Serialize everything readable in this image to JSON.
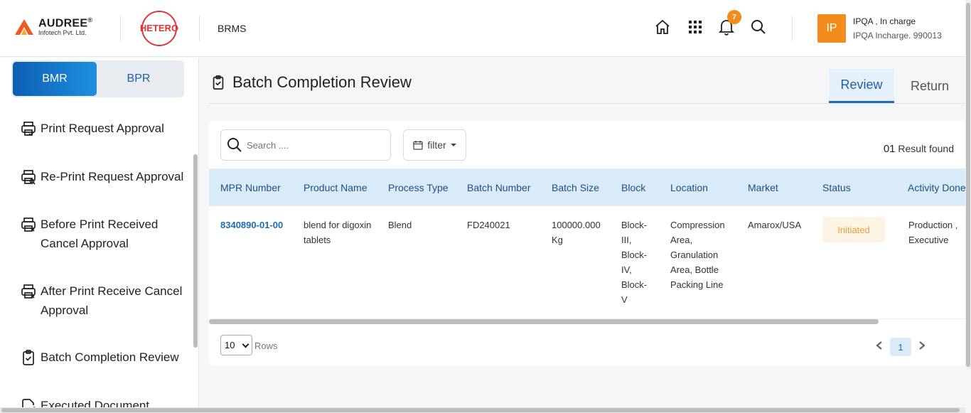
{
  "brand": {
    "company": "AUDREE",
    "company_mark": "®",
    "company_sub": "Infotech Pvt. Ltd.",
    "partner": "HETERO",
    "app_name": "BRMS"
  },
  "header": {
    "notification_count": "7",
    "avatar_initials": "IP",
    "user_name": "IPQA , In charge",
    "user_role": "IPQA Incharge. 990013"
  },
  "sidebar": {
    "segments": [
      {
        "label": "BMR",
        "active": true
      },
      {
        "label": "BPR",
        "active": false
      }
    ],
    "items": [
      {
        "label": "Print Request Approval",
        "icon": "printer-check-icon"
      },
      {
        "label": "Re-Print Request Approval",
        "icon": "printer-search-icon"
      },
      {
        "label": "Before Print Received Cancel Approval",
        "icon": "printer-cancel-icon"
      },
      {
        "label": "After Print Receive Cancel Approval",
        "icon": "printer-cancel-icon"
      },
      {
        "label": "Batch Completion Review",
        "icon": "clipboard-check-icon"
      },
      {
        "label": "Executed Document",
        "icon": "document-edit-icon"
      }
    ]
  },
  "main": {
    "title": "Batch Completion Review",
    "tabs": [
      {
        "label": "Review",
        "active": true
      },
      {
        "label": "Return",
        "active": false
      }
    ],
    "search_placeholder": "Search ....",
    "filter_label": "filter",
    "result_count": "01",
    "result_text": "Result found",
    "table": {
      "columns": [
        "MPR Number",
        "Product Name",
        "Process Type",
        "Batch Number",
        "Batch Size",
        "Block",
        "Location",
        "Market",
        "Status",
        "Activity Done"
      ],
      "rows": [
        {
          "mpr_number": "8340890-01-00",
          "product_name": "blend for digoxin tablets",
          "process_type": "Blend",
          "batch_number": "FD240021",
          "batch_size": "100000.000 Kg",
          "block": "Block-III, Block-IV, Block-V",
          "location": "Compression Area, Granulation Area, Bottle Packing Line",
          "market": "Amarox/USA",
          "status": "Initiated",
          "activity_done": "Production , Executive"
        }
      ]
    },
    "rows_per_page": "10",
    "rows_label": "Rows",
    "current_page": "1"
  },
  "colors": {
    "primary": "#1e6bb8",
    "accent_orange": "#f28c1d",
    "table_header_bg": "#d9ebf8",
    "status_initiated": "#e9a03b"
  }
}
